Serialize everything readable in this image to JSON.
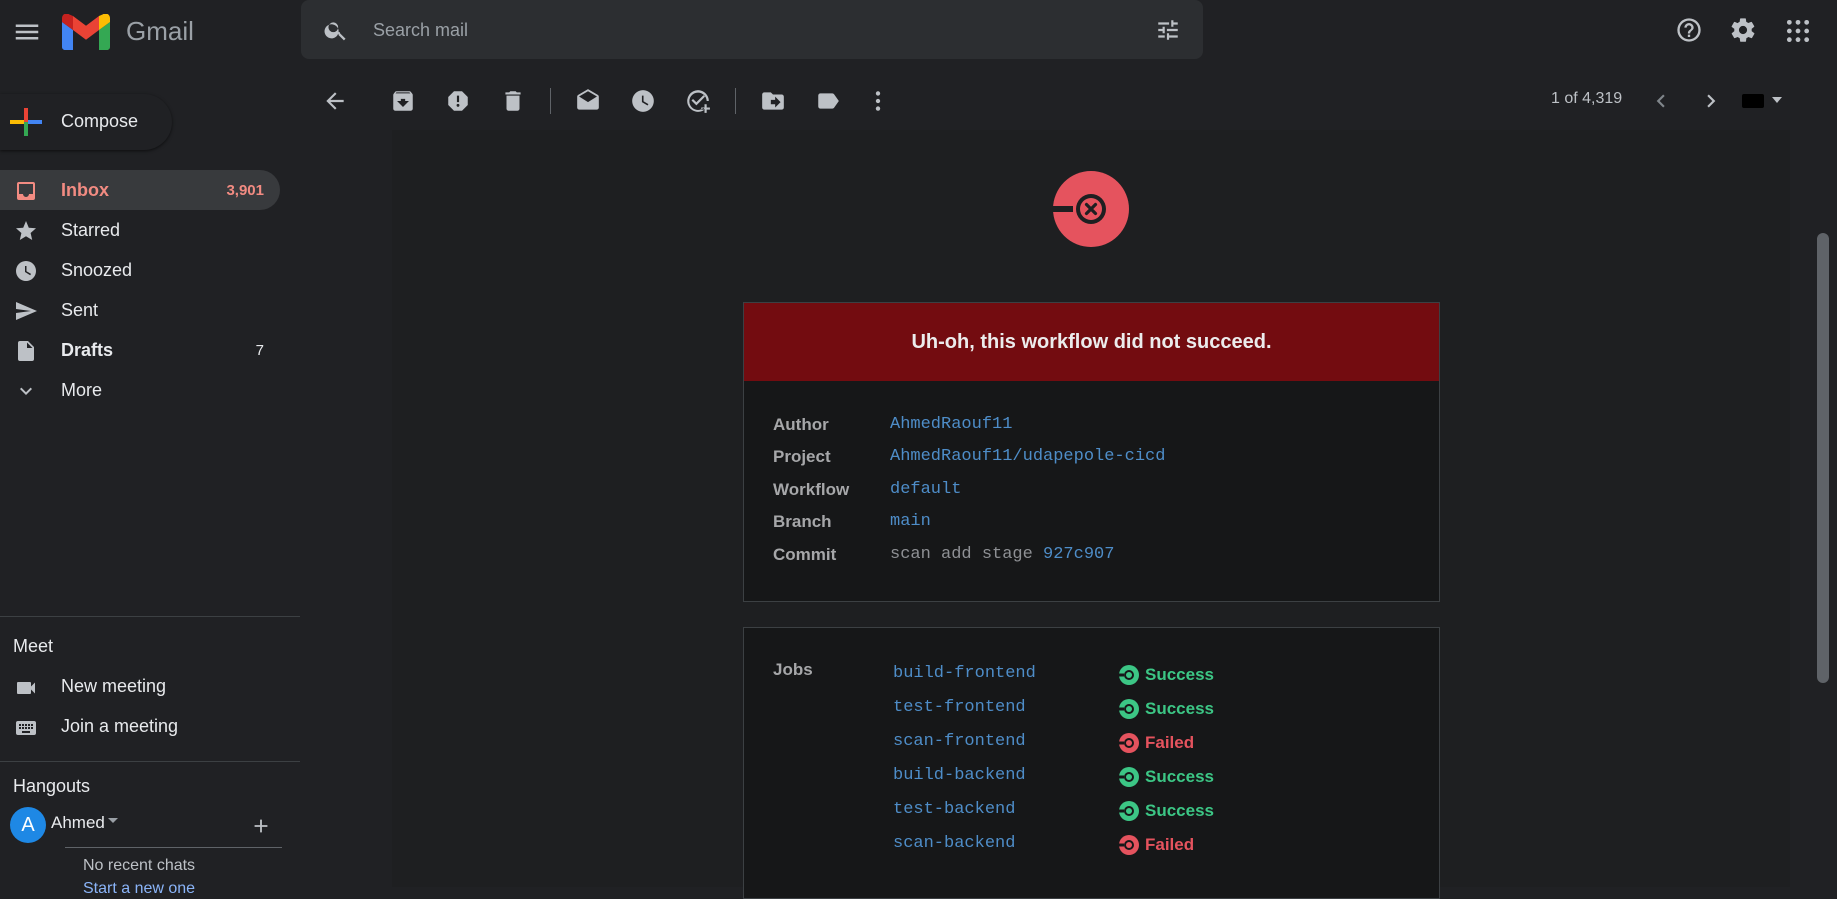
{
  "app": {
    "brand": "Gmail"
  },
  "search": {
    "placeholder": "Search mail"
  },
  "compose": {
    "label": "Compose"
  },
  "nav": {
    "items": [
      {
        "label": "Inbox",
        "count": "3,901"
      },
      {
        "label": "Starred",
        "count": ""
      },
      {
        "label": "Snoozed",
        "count": ""
      },
      {
        "label": "Sent",
        "count": ""
      },
      {
        "label": "Drafts",
        "count": "7"
      },
      {
        "label": "More",
        "count": ""
      }
    ]
  },
  "meet": {
    "title": "Meet",
    "new_meeting": "New meeting",
    "join_meeting": "Join a meeting"
  },
  "hangouts": {
    "title": "Hangouts",
    "avatar_letter": "A",
    "user": "Ahmed",
    "empty_text": "No recent chats",
    "start_link": "Start a new one"
  },
  "toolbar": {
    "pager": "1 of 4,319"
  },
  "email": {
    "banner": "Uh-oh, this workflow did not succeed.",
    "details": [
      {
        "key": "Author",
        "value": "AhmedRaouf11"
      },
      {
        "key": "Project",
        "value": "AhmedRaouf11/udapepole-cicd"
      },
      {
        "key": "Workflow",
        "value": "default"
      },
      {
        "key": "Branch",
        "value": "main"
      },
      {
        "key": "Commit",
        "value": "scan add stage",
        "hash": "927c907"
      }
    ],
    "jobs_title": "Jobs",
    "jobs": [
      {
        "name": "build-frontend",
        "status": "Success"
      },
      {
        "name": "test-frontend",
        "status": "Success"
      },
      {
        "name": "scan-frontend",
        "status": "Failed"
      },
      {
        "name": "build-backend",
        "status": "Success"
      },
      {
        "name": "test-backend",
        "status": "Success"
      },
      {
        "name": "scan-backend",
        "status": "Failed"
      }
    ]
  },
  "colors": {
    "failure": "#e5535e",
    "success": "#3cc685",
    "banner": "#730c10",
    "link": "#4e8dc8",
    "inbox_accent": "#f28b82"
  },
  "icons": {
    "toolbar": [
      "back-icon",
      "archive-icon",
      "report-spam-icon",
      "delete-icon",
      "mark-unread-icon",
      "snooze-icon",
      "add-task-icon",
      "move-to-icon",
      "label-icon",
      "more-icon"
    ]
  }
}
